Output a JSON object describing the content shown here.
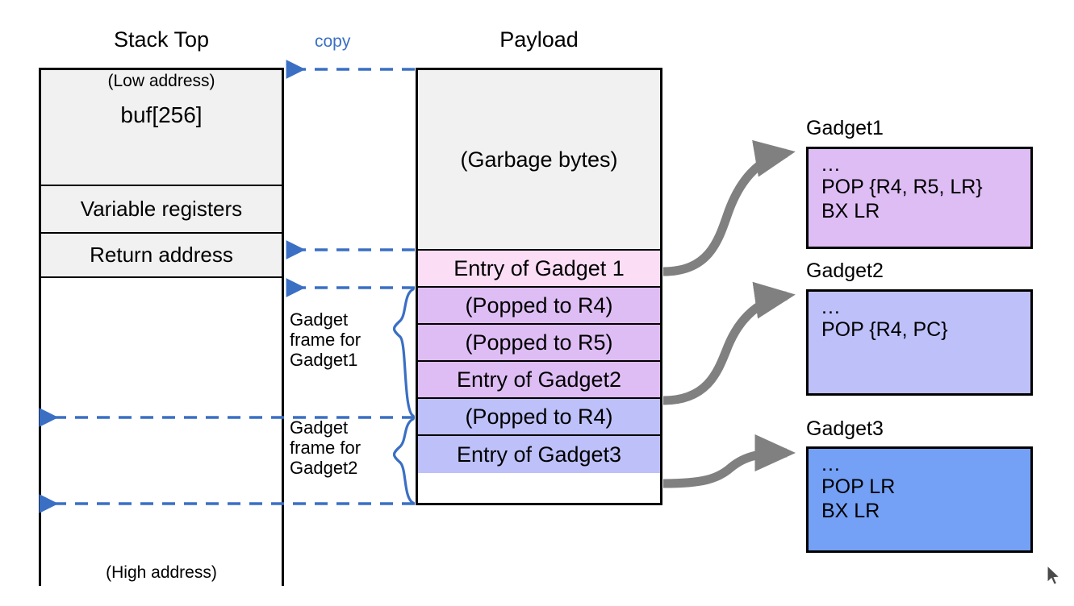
{
  "diagram": {
    "headings": {
      "stack": "Stack Top",
      "payload": "Payload"
    },
    "copy_label": "copy",
    "stack": {
      "low_address": "(Low address)",
      "high_address": "(High address)",
      "cells": [
        {
          "label": "buf[256]"
        },
        {
          "label": "Variable registers"
        },
        {
          "label": "Return address"
        }
      ]
    },
    "payload": {
      "cells": [
        {
          "label": "(Garbage bytes)",
          "color": "#f1f1f1"
        },
        {
          "label": "Entry of Gadget 1",
          "color": "#fbddf6"
        },
        {
          "label": "(Popped to R4)",
          "color": "#debdf5"
        },
        {
          "label": "(Popped to R5)",
          "color": "#debdf5"
        },
        {
          "label": "Entry of Gadget2",
          "color": "#debdf5"
        },
        {
          "label": "(Popped to R4)",
          "color": "#bec0fa"
        },
        {
          "label": "Entry of Gadget3",
          "color": "#bec0fa"
        }
      ]
    },
    "frames": [
      {
        "line1": "Gadget",
        "line2": "frame for",
        "line3": "Gadget1"
      },
      {
        "line1": "Gadget",
        "line2": "frame for",
        "line3": "Gadget2"
      }
    ],
    "gadgets": [
      {
        "title": "Gadget1",
        "color": "#debdf5",
        "lines": [
          "...",
          "POP {R4, R5, LR}",
          "BX LR"
        ]
      },
      {
        "title": "Gadget2",
        "color": "#bec0fa",
        "lines": [
          "...",
          "POP {R4, PC}"
        ]
      },
      {
        "title": "Gadget3",
        "color": "#74a0f5",
        "lines": [
          "...",
          "POP LR",
          "BX LR"
        ]
      }
    ],
    "colors": {
      "dashed_arrow": "#3a6fc4",
      "flow_arrow": "#808080",
      "brace": "#3a6fc4",
      "outline": "#000000"
    }
  }
}
